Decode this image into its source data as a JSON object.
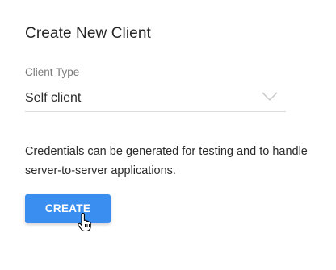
{
  "dialog": {
    "title": "Create New Client",
    "client_type": {
      "label": "Client Type",
      "selected_value": "Self client",
      "chevron_icon": "chevron-down-icon"
    },
    "description_line1": "Credentials can be generated for testing and to handle",
    "description_line2": "server-to-server applications.",
    "create_button_label": "CREATE",
    "cursor_icon": "hand-pointer-icon"
  },
  "colors": {
    "primary_button": "#3a8ef0",
    "text": "#2b2b2b",
    "label": "#7a7a7a",
    "divider": "#dcdcdc"
  }
}
